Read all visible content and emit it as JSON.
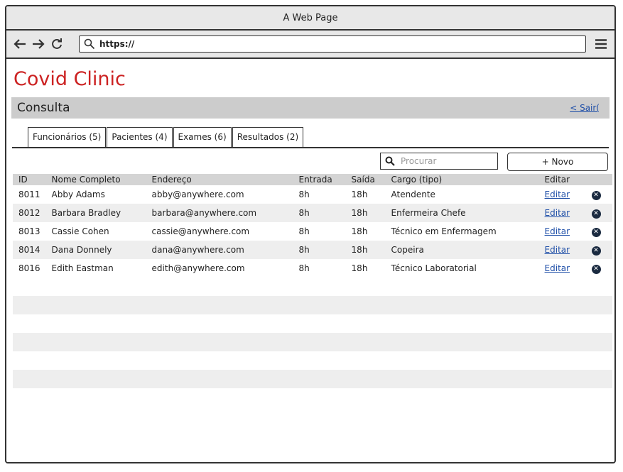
{
  "browser": {
    "title": "A Web Page",
    "url": "https://"
  },
  "brand": "Covid Clinic",
  "header": {
    "title": "Consulta",
    "logout": "< Sair("
  },
  "tabs": [
    {
      "label": "Funcionários (5)"
    },
    {
      "label": "Pacientes (4)"
    },
    {
      "label": "Exames (6)"
    },
    {
      "label": "Resultados (2)"
    }
  ],
  "search": {
    "placeholder": "Procurar"
  },
  "new_button": "+ Novo",
  "table": {
    "columns": [
      "ID",
      "Nome Completo",
      "Endereço",
      "Entrada",
      "Saída",
      "Cargo (tipo)",
      "Editar"
    ],
    "rows": [
      {
        "id": "8011",
        "name": "Abby Adams",
        "email": "abby@anywhere.com",
        "entrada": "8h",
        "saida": "18h",
        "cargo": "Atendente",
        "edit": "Editar"
      },
      {
        "id": "8012",
        "name": "Barbara Bradley",
        "email": "barbara@anywhere.com",
        "entrada": "8h",
        "saida": "18h",
        "cargo": "Enfermeira Chefe",
        "edit": "Editar"
      },
      {
        "id": "8013",
        "name": "Cassie Cohen",
        "email": "cassie@anywhere.com",
        "entrada": "8h",
        "saida": "18h",
        "cargo": "Técnico em Enfermagem",
        "edit": "Editar"
      },
      {
        "id": "8014",
        "name": "Dana Donnely",
        "email": "dana@anywhere.com",
        "entrada": "8h",
        "saida": "18h",
        "cargo": "Copeira",
        "edit": "Editar"
      },
      {
        "id": "8016",
        "name": "Edith Eastman",
        "email": "edith@anywhere.com",
        "entrada": "8h",
        "saida": "18h",
        "cargo": "Técnico Laboratorial",
        "edit": "Editar"
      }
    ]
  },
  "colors": {
    "brand": "#cc2222",
    "link": "#1f4fa8",
    "header_bg": "#cccccc",
    "row_alt": "#eeeeee"
  },
  "icons": [
    "back-arrow-icon",
    "forward-arrow-icon",
    "reload-icon",
    "search-icon",
    "hamburger-menu-icon",
    "delete-icon"
  ]
}
